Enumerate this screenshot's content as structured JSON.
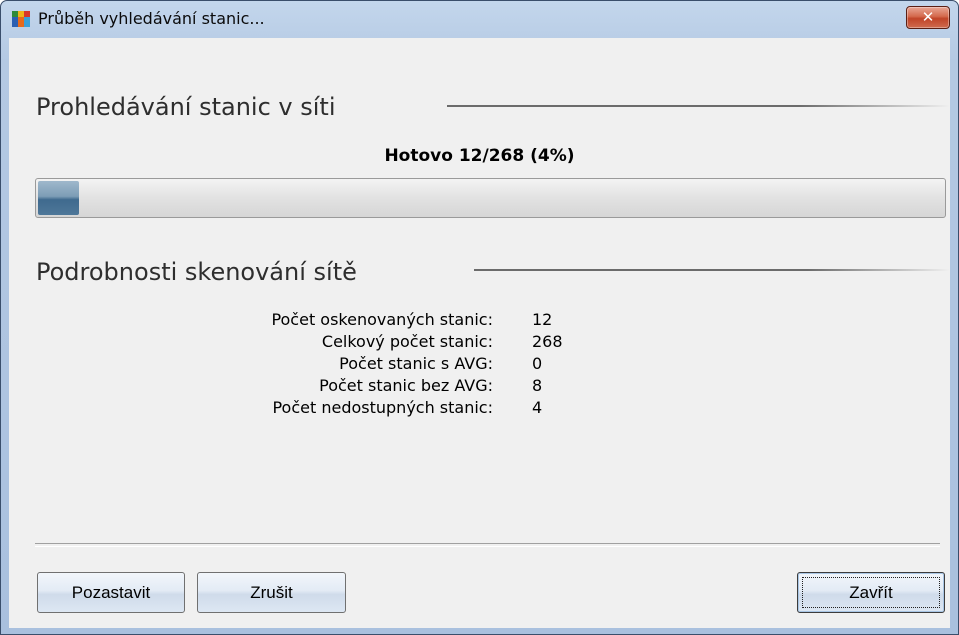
{
  "window": {
    "title": "Průběh vyhledávání stanic...",
    "close_symbol": "✕",
    "icon": "avg-logo-icon"
  },
  "scan_section": {
    "title": "Prohledávání stanic v síti",
    "progress_text": "Hotovo 12/268 (4%)",
    "progress_fraction": 0.045
  },
  "details_section": {
    "title": "Podrobnosti skenování sítě",
    "rows": [
      {
        "label": "Počet oskenovaných stanic:",
        "value": "12"
      },
      {
        "label": "Celkový počet stanic:",
        "value": "268"
      },
      {
        "label": "Počet stanic s AVG:",
        "value": "0"
      },
      {
        "label": "Počet stanic bez AVG:",
        "value": "8"
      },
      {
        "label": "Počet nedostupných stanic:",
        "value": "4"
      }
    ]
  },
  "buttons": {
    "pause": "Pozastavit",
    "cancel": "Zrušit",
    "close": "Zavřít"
  },
  "colors": {
    "accent": "#4e7799",
    "close_button": "#c04428"
  }
}
